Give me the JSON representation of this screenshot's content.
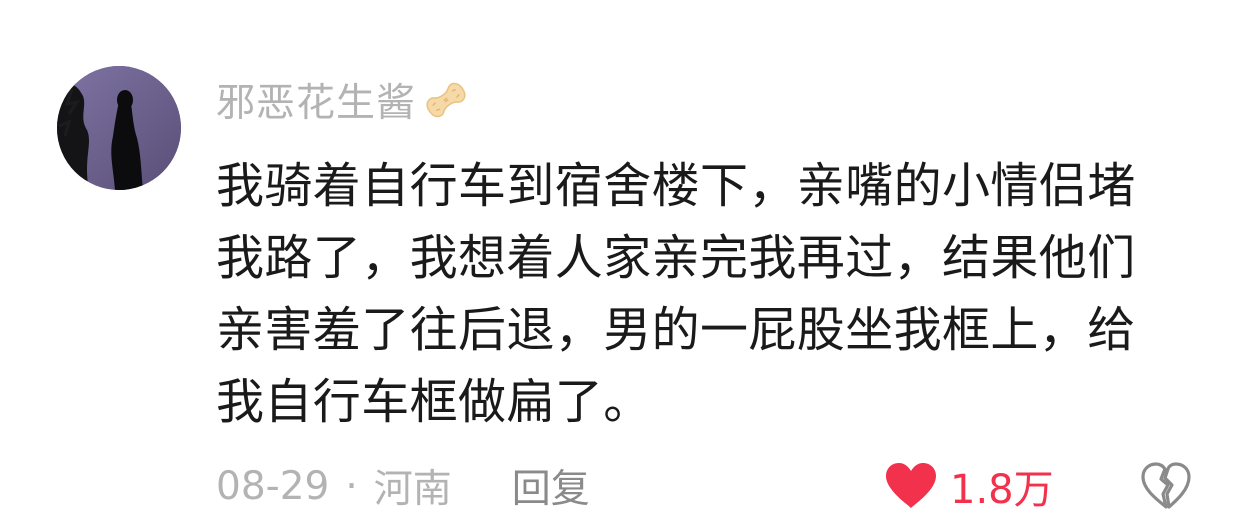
{
  "comment": {
    "username": "邪恶花生酱",
    "badge_icon": "peanut-icon",
    "content_lines": [
      "我骑着自行车到宿舍楼下，亲嘴的小情侣堵",
      "我路了，我想着人家亲完我再过，结果他们",
      "亲害羞了往后退，男的一屁股坐我框上，给",
      "我自行车框做扁了。"
    ],
    "date": "08-29",
    "separator": "·",
    "location": "河南",
    "reply_label": "回复",
    "like_icon": "heart-icon",
    "like_count": "1.8万",
    "dislike_icon": "broken-heart-icon"
  },
  "colors": {
    "like_red": "#f2324c",
    "meta_gray": "#b3b3b3",
    "text_dark": "#1a1a1a"
  }
}
